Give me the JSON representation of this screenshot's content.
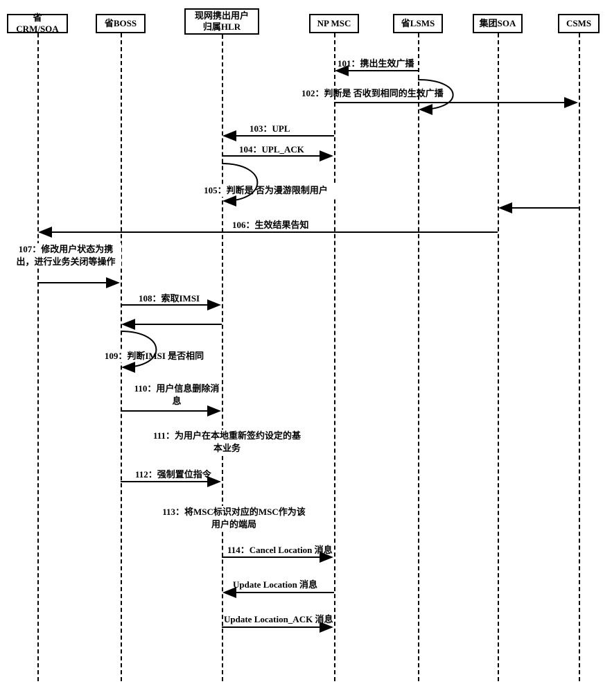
{
  "participants": [
    {
      "id": "crm_soa",
      "label": "省CRM/SOA"
    },
    {
      "id": "boss",
      "label": "省BOSS"
    },
    {
      "id": "hlr",
      "label": "现网携出用户\n归属HLR"
    },
    {
      "id": "npmsc",
      "label": "NP MSC"
    },
    {
      "id": "lsms",
      "label": "省LSMS"
    },
    {
      "id": "group_soa",
      "label": "集团SOA"
    },
    {
      "id": "csms",
      "label": "CSMS"
    }
  ],
  "messages": {
    "m101": "101：携出生效广播",
    "m102": "102：判断是 否收到相同的生效广播",
    "m103": "103：UPL",
    "m104": "104：UPL_ACK",
    "m105": "105：判断是 否为漫游限制用户",
    "m106": "106：生效结果告知",
    "m107": "107：修改用户状态为携出，进行业务关闭等操作",
    "m108": "108：索取IMSI",
    "m109": "109：判断IMSI 是否相同",
    "m110": "110：用户信息删除消息",
    "m111": "111：为用户在本地重新签约设定的基本业务",
    "m112": "112：强制置位指令",
    "m113": "113：将MSC标识对应的MSC作为该 用户的端局",
    "m114": "114：Cancel Location 消息",
    "m_upd": "Update Location 消息",
    "m_upd_ack": "Update Location_ACK 消息"
  }
}
